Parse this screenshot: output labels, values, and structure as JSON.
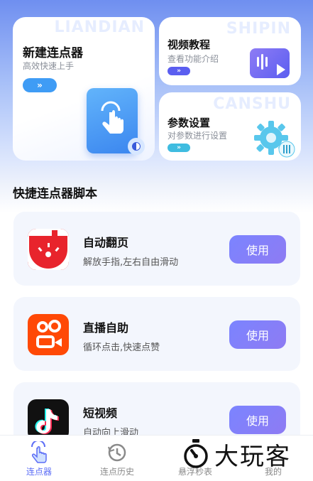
{
  "cards": {
    "new_clicker": {
      "title": "新建连点器",
      "subtitle": "高效快速上手",
      "watermark": "LIANDIAN"
    },
    "video": {
      "title": "视频教程",
      "subtitle": "查看功能介绍",
      "watermark": "SHIPIN"
    },
    "settings": {
      "title": "参数设置",
      "subtitle": "对参数进行设置",
      "watermark": "CANSHU"
    }
  },
  "section": {
    "title": "快捷连点器脚本"
  },
  "scripts": [
    {
      "name": "自动翻页",
      "desc": "解放手指,左右自由滑动",
      "button": "使用",
      "icon": "reader-app-icon"
    },
    {
      "name": "直播自助",
      "desc": "循环点击,快速点赞",
      "button": "使用",
      "icon": "kuaishou-app-icon"
    },
    {
      "name": "短视频",
      "desc": "自动向上滑动",
      "button": "使用",
      "icon": "douyin-app-icon"
    }
  ],
  "tabs": [
    {
      "label": "连点器",
      "icon": "tap-hand-icon",
      "active": true
    },
    {
      "label": "连点历史",
      "icon": "history-icon",
      "active": false
    },
    {
      "label": "悬浮秒表",
      "icon": "stopwatch-icon",
      "active": false
    },
    {
      "label": "我的",
      "icon": "user-icon",
      "active": false
    }
  ],
  "watermark": {
    "text": "大玩客"
  },
  "colors": {
    "accent": "#5b6cf6",
    "button": "#7b84ff"
  }
}
